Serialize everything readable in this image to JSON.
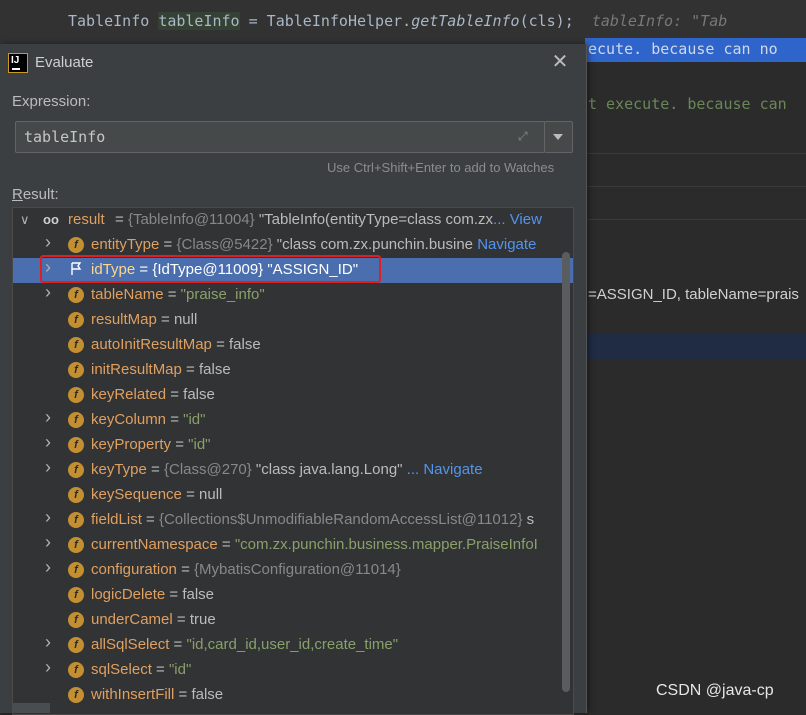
{
  "editor": {
    "code_prefix": "TableInfo ",
    "code_var": "tableInfo",
    "code_mid": " = TableInfoHelper.",
    "code_call": "getTableInfo",
    "code_end": "(cls);",
    "inline_hint": "tableInfo: \"Tab",
    "warn_top": "ecute. because can no",
    "warn_mid": "t execute. because can",
    "tostring_fragment": "=ASSIGN_ID, tableName=prais"
  },
  "dialog": {
    "title": "Evaluate",
    "expression_label": "Expression:",
    "expression_value": "tableInfo",
    "watch_hint": "Use Ctrl+Shift+Enter to add to Watches",
    "result_label": "Result:"
  },
  "tree": {
    "root": {
      "name": "result",
      "ref": "{TableInfo@11004}",
      "value": "\"TableInfo(entityType=class com.zx",
      "link": "... View"
    },
    "rows": [
      {
        "name": "entityType",
        "eq": " = ",
        "ref": "{Class@5422}",
        "value": " \"class com.zx.punchin.busine",
        "link": " Navigate",
        "expandable": true
      },
      {
        "name": "idType",
        "eq": " = ",
        "ref": "{IdType@11009}",
        "value": " \"ASSIGN_ID\"",
        "link": "",
        "expandable": true,
        "selected": true
      },
      {
        "name": "tableName",
        "eq": " = ",
        "ref": "",
        "str": "\"praise_info\"",
        "expandable": true
      },
      {
        "name": "resultMap",
        "eq": " = ",
        "value": "null",
        "expandable": false
      },
      {
        "name": "autoInitResultMap",
        "eq": " = ",
        "value": "false",
        "expandable": false
      },
      {
        "name": "initResultMap",
        "eq": " = ",
        "value": "false",
        "expandable": false
      },
      {
        "name": "keyRelated",
        "eq": " = ",
        "value": "false",
        "expandable": false
      },
      {
        "name": "keyColumn",
        "eq": " = ",
        "str": "\"id\"",
        "expandable": true
      },
      {
        "name": "keyProperty",
        "eq": " = ",
        "str": "\"id\"",
        "expandable": true
      },
      {
        "name": "keyType",
        "eq": " = ",
        "ref": "{Class@270}",
        "value": " \"class java.lang.Long\"",
        "link": " ... Navigate",
        "expandable": true
      },
      {
        "name": "keySequence",
        "eq": " = ",
        "value": "null",
        "expandable": false
      },
      {
        "name": "fieldList",
        "eq": " = ",
        "ref": "{Collections$UnmodifiableRandomAccessList@11012}",
        "value": " s",
        "expandable": true
      },
      {
        "name": "currentNamespace",
        "eq": " = ",
        "str": "\"com.zx.punchin.business.mapper.PraiseInfoI",
        "expandable": true
      },
      {
        "name": "configuration",
        "eq": " = ",
        "ref": "{MybatisConfiguration@11014}",
        "expandable": true
      },
      {
        "name": "logicDelete",
        "eq": " = ",
        "value": "false",
        "expandable": false
      },
      {
        "name": "underCamel",
        "eq": " = ",
        "value": "true",
        "expandable": false
      },
      {
        "name": "allSqlSelect",
        "eq": " = ",
        "str": "\"id,card_id,user_id,create_time\"",
        "expandable": true
      },
      {
        "name": "sqlSelect",
        "eq": " = ",
        "str": "\"id\"",
        "expandable": true
      },
      {
        "name": "withInsertFill",
        "eq": " = ",
        "value": "false",
        "expandable": false
      }
    ]
  },
  "watermark": "CSDN @java-cp",
  "colors": {
    "selection": "#4b6eaf",
    "highlight_box": "#e02020",
    "field_icon": "#c38f31"
  }
}
